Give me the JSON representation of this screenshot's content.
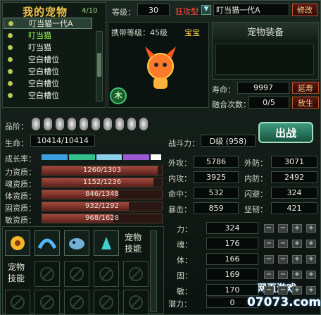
{
  "panel_title": "我的宠物",
  "pet_count": "4/10",
  "pet_list": [
    "叮当猫一代A",
    "叮当猫",
    "叮当猫",
    "空白槽位",
    "空白槽位",
    "空白槽位",
    "空白槽位"
  ],
  "header": {
    "level_label": "等级：",
    "level_value": "30",
    "type_label": "狂攻型",
    "name_value": "叮当猫一代A",
    "rename_btn": "修改"
  },
  "portrait": {
    "carry_level": "携带等级：45级",
    "tag": "宝宝",
    "element": "木"
  },
  "equip_title": "宠物装备",
  "life": {
    "label": "寿命：",
    "value": "9997",
    "btn": "延寿"
  },
  "fusion": {
    "label": "融合次数：",
    "value": "0/5",
    "btn": "放生"
  },
  "rank_label": "品阶：",
  "hp": {
    "label": "生命：",
    "value": "10414/10414"
  },
  "power": {
    "label": "战斗力：",
    "value": "D级 (958)"
  },
  "fight_btn": "出战",
  "growth_label": "成长率：",
  "growth_colors": [
    "#3aa0e0",
    "#35c08a",
    "#8ad0e8",
    "#9b59d6",
    "#ffffff"
  ],
  "aptitudes": [
    {
      "label": "力资质：",
      "value": "1260/1303",
      "fill": 0.967
    },
    {
      "label": "魂资质：",
      "value": "1152/1236",
      "fill": 0.932
    },
    {
      "label": "体资质：",
      "value": "846/1348",
      "fill": 0.628
    },
    {
      "label": "固资质：",
      "value": "932/1292",
      "fill": 0.721
    },
    {
      "label": "敏资质：",
      "value": "968/1628",
      "fill": 0.595
    }
  ],
  "combat": [
    {
      "l1": "外攻：",
      "v1": "5786",
      "l2": "外防：",
      "v2": "3071"
    },
    {
      "l1": "内攻：",
      "v1": "3925",
      "l2": "内防：",
      "v2": "2492"
    },
    {
      "l1": "命中：",
      "v1": "532",
      "l2": "闪避：",
      "v2": "324"
    },
    {
      "l1": "暴击：",
      "v1": "859",
      "l2": "坚韧：",
      "v2": "421"
    }
  ],
  "attrs": [
    {
      "label": "力：",
      "value": "324"
    },
    {
      "label": "魂：",
      "value": "176"
    },
    {
      "label": "体：",
      "value": "166"
    },
    {
      "label": "固：",
      "value": "169"
    },
    {
      "label": "敏：",
      "value": "170"
    }
  ],
  "potential": {
    "label": "潜力：",
    "value": "0"
  },
  "pet_skill_label": "宠物技能",
  "pet_skill_label2": "宠物技能",
  "watermark": {
    "main": "网页游戏",
    "site": "07073.com"
  }
}
